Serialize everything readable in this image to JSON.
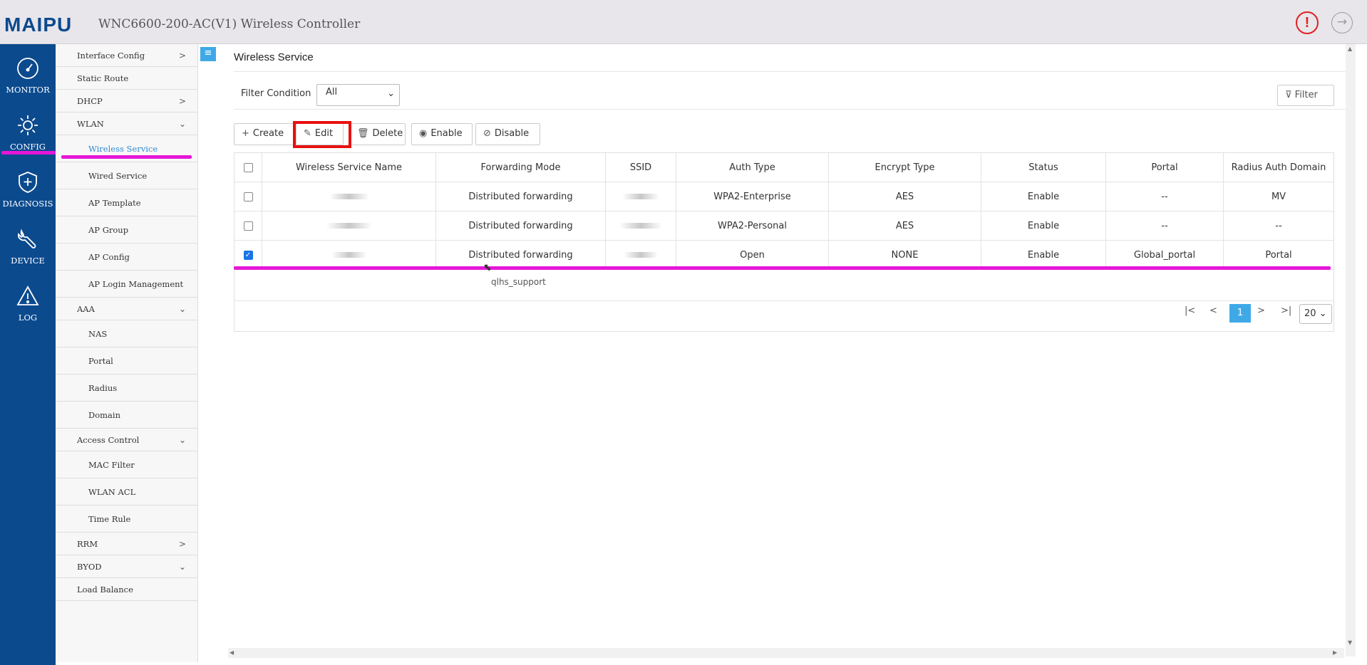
{
  "header": {
    "brand": "MAIPU",
    "title": "WNC6600-200-AC(V1) Wireless Controller",
    "alert_symbol": "!",
    "logout_symbol": "→",
    "brand_color": "#0c4a8e"
  },
  "leftnav": {
    "items": [
      {
        "label": "MONITOR",
        "icon": "gauge-icon"
      },
      {
        "label": "CONFIG",
        "icon": "gear-icon"
      },
      {
        "label": "DIAGNOSIS",
        "icon": "shield-plus-icon"
      },
      {
        "label": "DEVICE",
        "icon": "wrench-icon"
      },
      {
        "label": "LOG",
        "icon": "warning-icon"
      }
    ]
  },
  "submenu": {
    "items": [
      {
        "label": "Interface Config"
      },
      {
        "label": "Static Route"
      },
      {
        "label": "DHCP"
      },
      {
        "label": "WLAN"
      },
      {
        "label": "Wireless Service"
      },
      {
        "label": "Wired Service"
      },
      {
        "label": "AP Template"
      },
      {
        "label": "AP Group"
      },
      {
        "label": "AP Config"
      },
      {
        "label": "AP Login Management"
      },
      {
        "label": "AAA"
      },
      {
        "label": "NAS"
      },
      {
        "label": "Portal"
      },
      {
        "label": "Radius"
      },
      {
        "label": "Domain"
      },
      {
        "label": "Access Control"
      },
      {
        "label": "MAC Filter"
      },
      {
        "label": "WLAN ACL"
      },
      {
        "label": "Time Rule"
      },
      {
        "label": "RRM"
      },
      {
        "label": "BYOD"
      },
      {
        "label": "Load Balance"
      }
    ]
  },
  "main": {
    "page_title": "Wireless Service",
    "filter_label": "Filter Condition",
    "filter_value": "All",
    "filter_button": "Filter",
    "toolbar": {
      "create": "Create",
      "edit": "Edit",
      "delete": "Delete",
      "enable": "Enable",
      "disable": "Disable"
    },
    "table": {
      "columns": [
        "Wireless Service Name",
        "Forwarding Mode",
        "SSID",
        "Auth Type",
        "Encrypt Type",
        "Status",
        "Portal",
        "Radius Auth Domain"
      ],
      "rows": [
        {
          "checked": false,
          "forwarding": "Distributed forwarding",
          "auth": "WPA2-Enterprise",
          "encrypt": "AES",
          "status": "Enable",
          "portal": "--",
          "radius": "MV"
        },
        {
          "checked": false,
          "forwarding": "Distributed forwarding",
          "auth": "WPA2-Personal",
          "encrypt": "AES",
          "status": "Enable",
          "portal": "--",
          "radius": "--"
        },
        {
          "checked": true,
          "forwarding": "Distributed forwarding",
          "auth": "Open",
          "encrypt": "NONE",
          "status": "Enable",
          "portal": "Global_portal",
          "radius": "Portal"
        }
      ]
    },
    "tooltip": "qlhs_support",
    "pager": {
      "first": "|<",
      "prev": "<",
      "current": "1",
      "next": ">",
      "last": ">|",
      "page_size": "20"
    }
  },
  "colors": {
    "accent": "#3fa9e8",
    "highlight_underline": "#e617d8",
    "edit_frame": "#e81010",
    "nav_bg": "#0c4a8e"
  }
}
